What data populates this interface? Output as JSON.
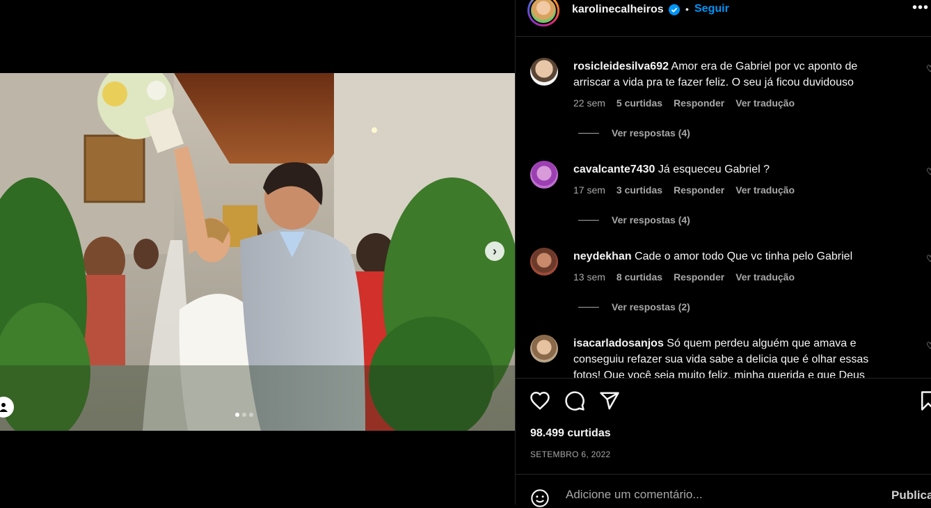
{
  "post": {
    "username": "karolinecalheiros",
    "follow_label": "Seguir",
    "bullet": "•",
    "more_label": "•••",
    "carousel": {
      "current": 1,
      "total": 3
    }
  },
  "comments": [
    {
      "username": "rosicleidesilva692",
      "text": "Amor era de Gabriel por vc aponto de arriscar a vida pra te fazer feliz. O seu já ficou duvidouso",
      "time": "22 sem",
      "likes": "5 curtidas",
      "reply": "Responder",
      "translate": "Ver tradução",
      "view_replies": "Ver respostas (4)"
    },
    {
      "username": "cavalcante7430",
      "text": "Já esqueceu Gabriel ?",
      "time": "17 sem",
      "likes": "3 curtidas",
      "reply": "Responder",
      "translate": "Ver tradução",
      "view_replies": "Ver respostas (4)"
    },
    {
      "username": "neydekhan",
      "text": "Cade o amor todo Que vc tinha pelo Gabriel",
      "time": "13 sem",
      "likes": "8 curtidas",
      "reply": "Responder",
      "translate": "Ver tradução",
      "view_replies": "Ver respostas (2)"
    },
    {
      "username": "isacarladosanjos",
      "text": "Só quem perdeu alguém que amava e conseguiu refazer sua vida sabe a delicia que é olhar essas fotos! Que você seja muito feliz, minha querida e que Deus"
    }
  ],
  "actions": {
    "likes_count": "98.499 curtidas",
    "date": "SETEMBRO 6, 2022",
    "comment_placeholder": "Adicione um comentário...",
    "publish_label": "Publicar"
  },
  "colors": {
    "background": "#000000",
    "link_blue": "#0095f6",
    "muted_text": "#a8a8a8",
    "divider": "#262626"
  }
}
